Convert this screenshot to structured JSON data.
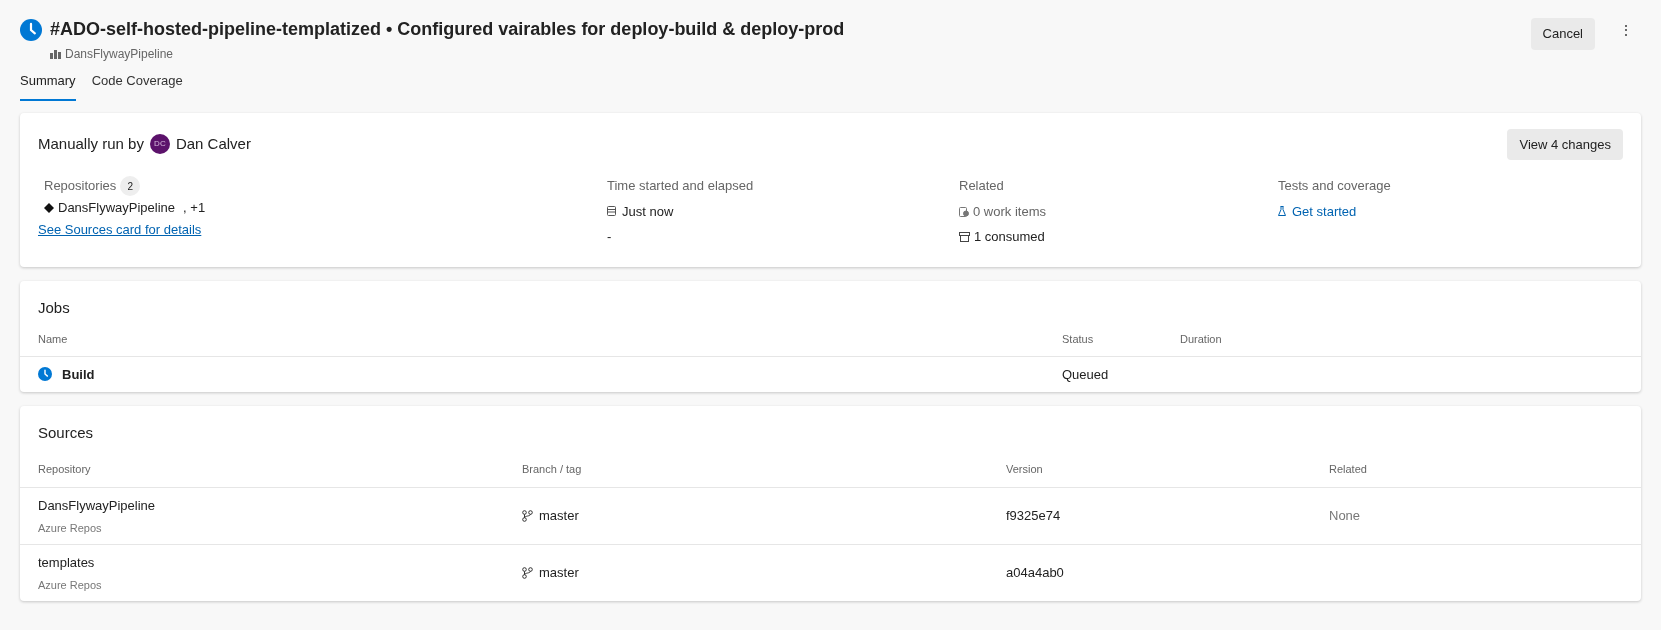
{
  "header": {
    "title": "#ADO-self-hosted-pipeline-templatized • Configured vairables for deploy-build & deploy-prod",
    "pipeline": "DansFlywayPipeline",
    "cancel": "Cancel",
    "more": "⋮"
  },
  "tabs": [
    {
      "label": "Summary",
      "selected": true
    },
    {
      "label": "Code Coverage",
      "selected": false
    }
  ],
  "summary": {
    "run_by": "Manually run by",
    "avatar": "DC",
    "user": "Dan Calver",
    "view_changes": "View 4 changes",
    "repositories": {
      "label": "Repositories",
      "count": "2",
      "repo": "DansFlywayPipeline",
      "more": ", +1",
      "link": "See Sources card for details"
    },
    "time": {
      "label": "Time started and elapsed",
      "started": "Just now",
      "elapsed": "-"
    },
    "related": {
      "label": "Related",
      "work_items": "0 work items",
      "consumed": "1 consumed"
    },
    "tests": {
      "label": "Tests and coverage",
      "link": "Get started"
    }
  },
  "jobs": {
    "title": "Jobs",
    "columns": [
      "Name",
      "Status",
      "Duration"
    ],
    "rows": [
      {
        "name": "Build",
        "status": "Queued"
      }
    ]
  },
  "sources": {
    "title": "Sources",
    "columns": [
      "Repository",
      "Branch / tag",
      "Version",
      "Related"
    ],
    "rows": [
      {
        "repository": "DansFlywayPipeline",
        "provider": "Azure Repos",
        "branch": "master",
        "version": "f9325e74",
        "related": "None"
      },
      {
        "repository": "templates",
        "provider": "Azure Repos",
        "branch": "master",
        "version": "a04a4ab0"
      }
    ]
  }
}
